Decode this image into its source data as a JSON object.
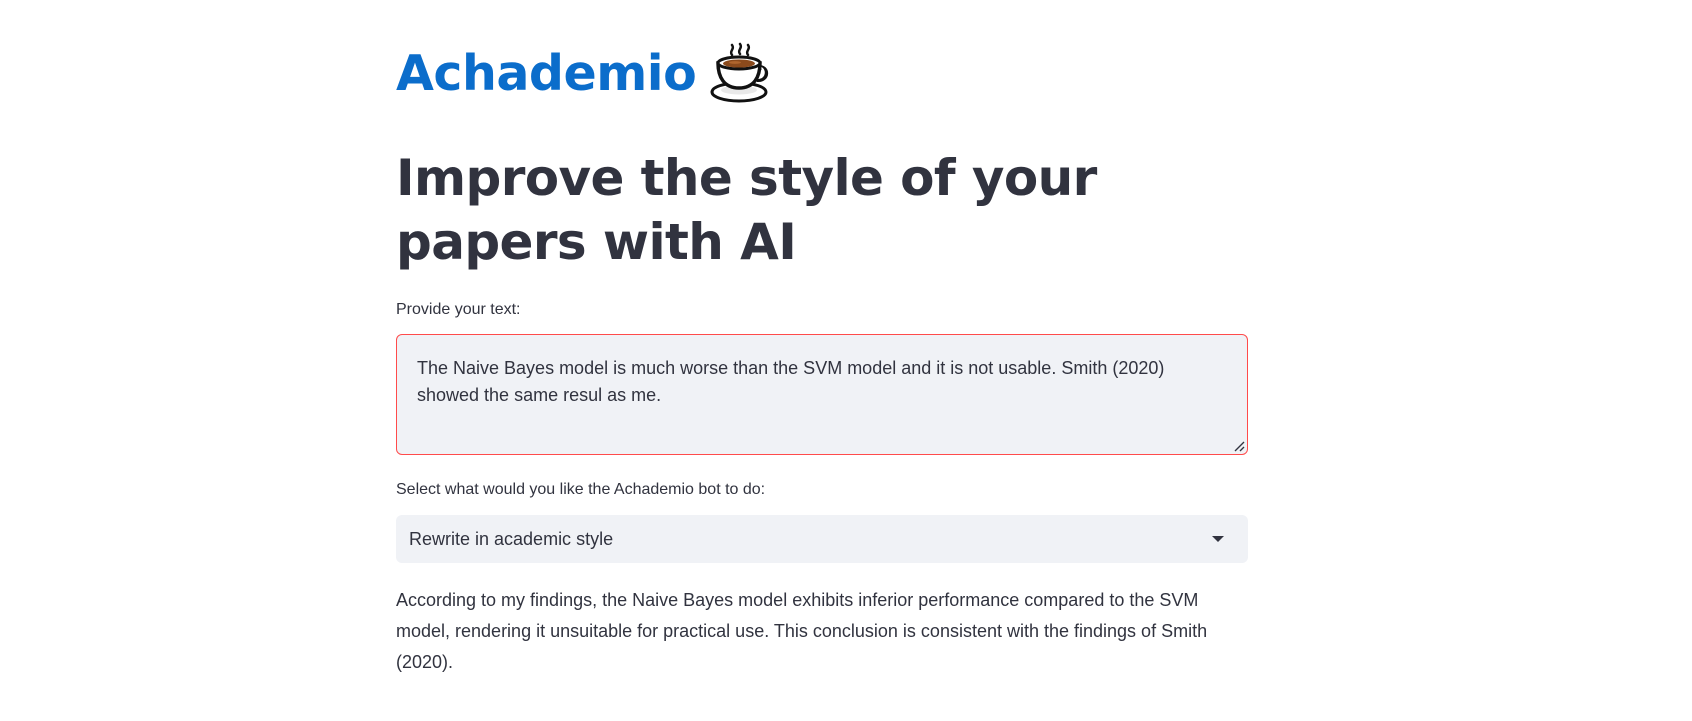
{
  "app": {
    "title": "Achademio",
    "logo_icon": "coffee-cup-icon",
    "accent_color": "#0b6dcb"
  },
  "headline": "Improve the style of your papers with AI",
  "text_input": {
    "label": "Provide your text:",
    "value": "The Naive Bayes model is much worse than the SVM model and it is not usable. Smith (2020) showed the same resul as me.",
    "border_color": "#ff4b4b"
  },
  "action_select": {
    "label": "Select what would you like the Achademio bot to do:",
    "selected": "Rewrite in academic style",
    "icon": "chevron-down-icon"
  },
  "output": {
    "text": "According to my findings, the Naive Bayes model exhibits inferior performance compared to the SVM model, rendering it unsuitable for practical use. This conclusion is consistent with the findings of Smith (2020)."
  }
}
